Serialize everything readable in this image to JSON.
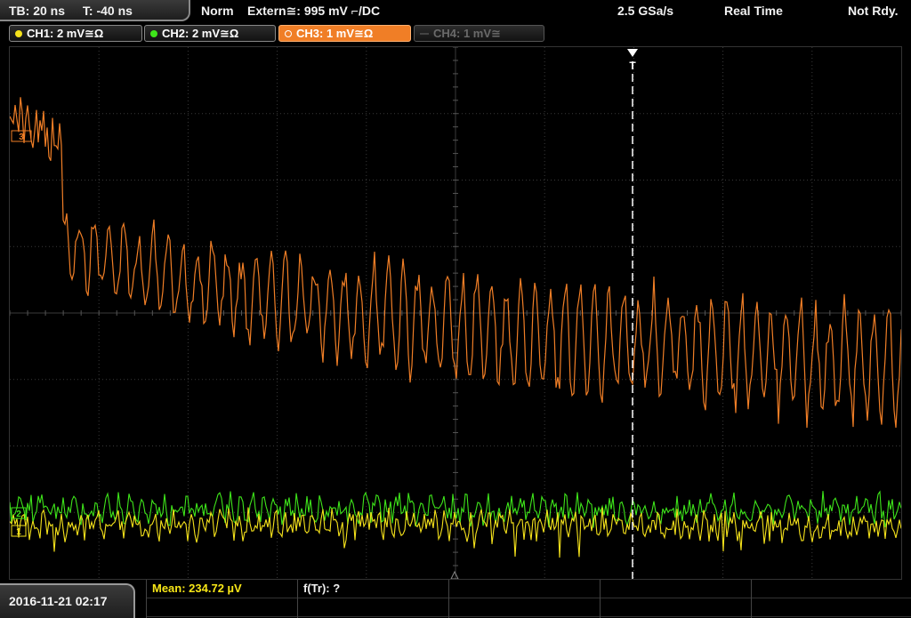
{
  "status_bar": {
    "timebase": "TB: 20 ns",
    "trigger_time": "T: -40 ns",
    "mode": "Norm",
    "trigger_source": "Extern≅: 995 mV ⌐/DC",
    "sample_rate": "2.5 GSa/s",
    "acquisition": "Real Time",
    "state": "Not Rdy."
  },
  "channels": [
    {
      "label": "CH1: 2 mV≅Ω",
      "color": "#f5e21b",
      "state": "on"
    },
    {
      "label": "CH2: 2 mV≅Ω",
      "color": "#3ee51a",
      "state": "on"
    },
    {
      "label": "CH3: 1 mV≅Ω",
      "color": "#f07e26",
      "state": "selected"
    },
    {
      "label": "CH4: 1 mV≅",
      "color": "#6a6a6a",
      "state": "off"
    }
  ],
  "markers": {
    "trigger": "T",
    "ch3_ref": "3",
    "ch1_ref": "1",
    "ch2_ref": "2"
  },
  "footer": {
    "datetime": "2016-11-21 02:17",
    "mean": "Mean: 234.72 µV",
    "freq": "f(Tr): ?"
  },
  "colors": {
    "ch1": "#f5e21b",
    "ch2": "#3ee51a",
    "ch3": "#f07e26",
    "grid": "#3a3a3a"
  }
}
